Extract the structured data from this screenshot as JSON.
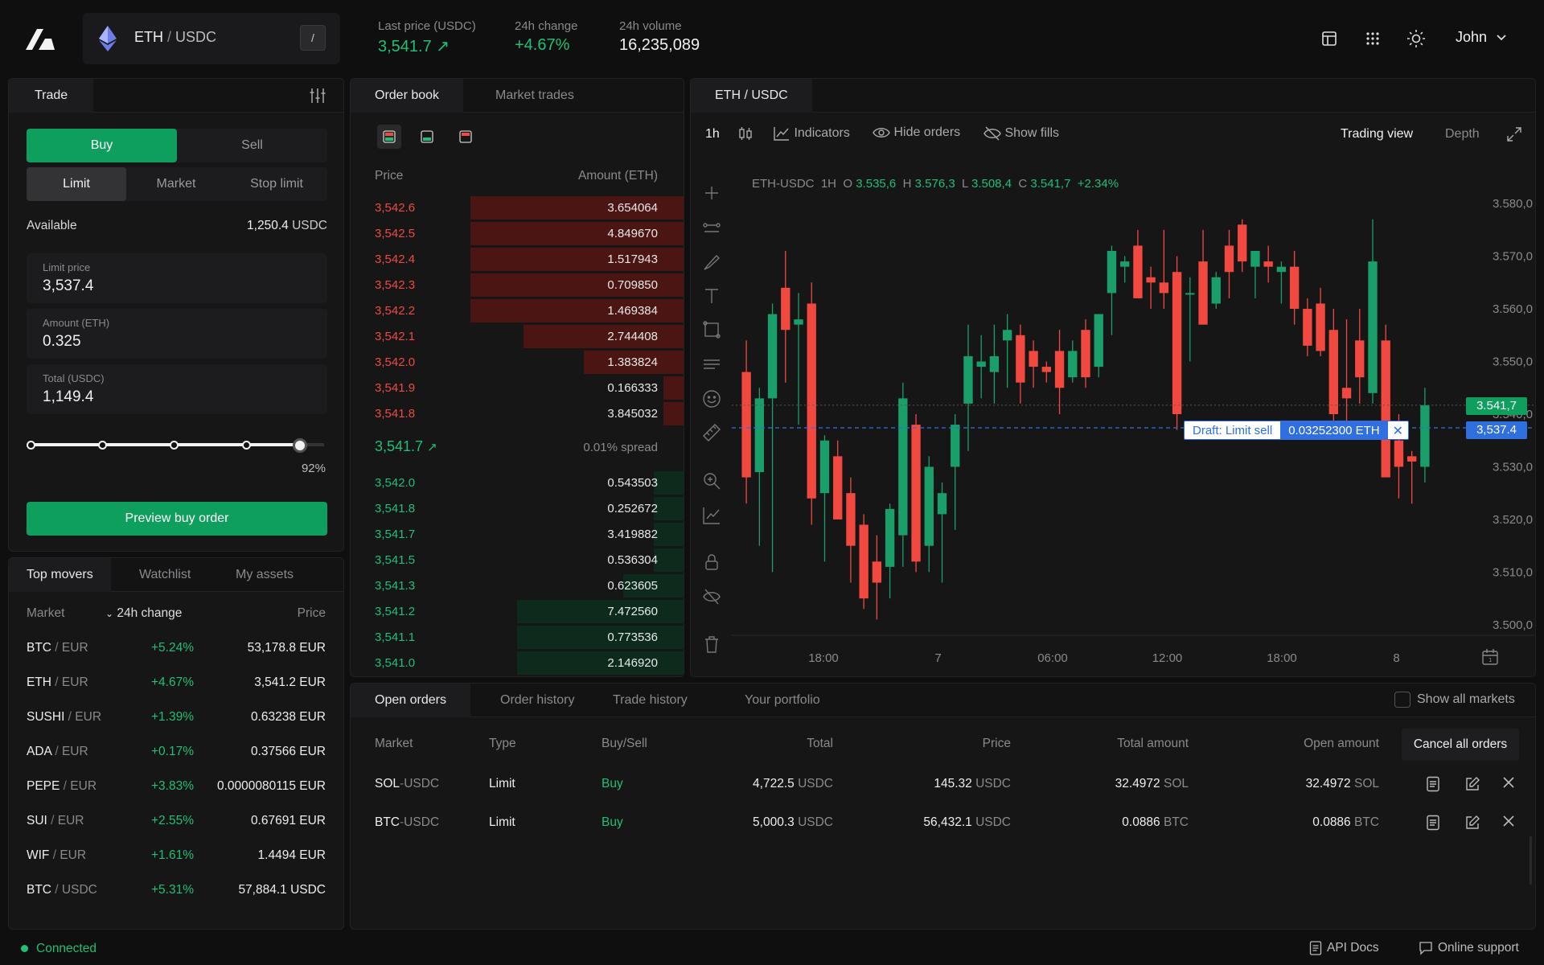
{
  "header": {
    "pair_base": "ETH",
    "pair_sep": "/",
    "pair_quote": "USDC",
    "shortcut": "/",
    "last_price_label": "Last price (USDC)",
    "last_price": "3,541.7",
    "change_label": "24h change",
    "change": "+4.67%",
    "volume_label": "24h volume",
    "volume": "16,235,089",
    "user": "John"
  },
  "trade": {
    "tab": "Trade",
    "buy": "Buy",
    "sell": "Sell",
    "order_types": [
      "Limit",
      "Market",
      "Stop limit"
    ],
    "available_label": "Available",
    "available_value": "1,250.4",
    "available_unit": "USDC",
    "limit_label": "Limit price",
    "limit_value": "3,537.4",
    "amount_label": "Amount (ETH)",
    "amount_value": "0.325",
    "total_label": "Total (USDC)",
    "total_value": "1,149.4",
    "slider_percent": 92,
    "slider_label": "92%",
    "preview_button": "Preview buy order"
  },
  "movers": {
    "tabs": [
      "Top movers",
      "Watchlist",
      "My assets"
    ],
    "col_market": "Market",
    "col_change": "24h change",
    "col_price": "Price",
    "rows": [
      {
        "base": "BTC",
        "quote": "EUR",
        "change": "+5.24%",
        "price": "53,178.8 EUR"
      },
      {
        "base": "ETH",
        "quote": "EUR",
        "change": "+4.67%",
        "price": "3,541.2 EUR"
      },
      {
        "base": "SUSHI",
        "quote": "EUR",
        "change": "+1.39%",
        "price": "0.63238 EUR"
      },
      {
        "base": "ADA",
        "quote": "EUR",
        "change": "+0.17%",
        "price": "0.37566 EUR"
      },
      {
        "base": "PEPE",
        "quote": "EUR",
        "change": "+3.83%",
        "price": "0.0000080115 EUR"
      },
      {
        "base": "SUI",
        "quote": "EUR",
        "change": "+2.55%",
        "price": "0.67691 EUR"
      },
      {
        "base": "WIF",
        "quote": "EUR",
        "change": "+1.61%",
        "price": "1.4494 EUR"
      },
      {
        "base": "BTC",
        "quote": "USDC",
        "change": "+5.31%",
        "price": "57,884.1 USDC"
      }
    ]
  },
  "orderbook": {
    "tabs": [
      "Order book",
      "Market trades"
    ],
    "col_price": "Price",
    "col_amount": "Amount (ETH)",
    "asks": [
      {
        "price": "3,542.6",
        "amount": "3.654064",
        "depth": 0.64
      },
      {
        "price": "3,542.5",
        "amount": "4.849670",
        "depth": 0.64
      },
      {
        "price": "3,542.4",
        "amount": "1.517943",
        "depth": 0.64
      },
      {
        "price": "3,542.3",
        "amount": "0.709850",
        "depth": 0.64
      },
      {
        "price": "3,542.2",
        "amount": "1.469384",
        "depth": 0.64
      },
      {
        "price": "3,542.1",
        "amount": "2.744408",
        "depth": 0.48
      },
      {
        "price": "3,542.0",
        "amount": "1.383824",
        "depth": 0.3
      },
      {
        "price": "3,541.9",
        "amount": "0.166333",
        "depth": 0.06
      },
      {
        "price": "3,541.8",
        "amount": "3.845032",
        "depth": 0.06
      }
    ],
    "mid_price": "3,541.7",
    "spread": "0.01% spread",
    "bids": [
      {
        "price": "3,542.0",
        "amount": "0.543503",
        "depth": 0.09
      },
      {
        "price": "3,541.8",
        "amount": "0.252672",
        "depth": 0.09
      },
      {
        "price": "3,541.7",
        "amount": "3.419882",
        "depth": 0.09
      },
      {
        "price": "3,541.5",
        "amount": "0.536304",
        "depth": 0.09
      },
      {
        "price": "3,541.3",
        "amount": "0.623605",
        "depth": 0.18
      },
      {
        "price": "3,541.2",
        "amount": "7.472560",
        "depth": 0.5
      },
      {
        "price": "3,541.1",
        "amount": "0.773536",
        "depth": 0.5
      },
      {
        "price": "3,541.0",
        "amount": "2.146920",
        "depth": 0.5
      }
    ]
  },
  "chart": {
    "tab": "ETH / USDC",
    "interval": "1h",
    "indicators": "Indicators",
    "hide_orders": "Hide orders",
    "show_fills": "Show fills",
    "trading_view": "Trading view",
    "depth": "Depth",
    "legend_symbol": "ETH-USDC",
    "legend_tf": "1H",
    "legend_o_label": "O",
    "legend_o": "3.535,6",
    "legend_h_label": "H",
    "legend_h": "3.576,3",
    "legend_l_label": "L",
    "legend_l": "3.508,4",
    "legend_c_label": "C",
    "legend_c": "3.541,7",
    "legend_change": "+2.34%",
    "draft_label": "Draft: Limit sell",
    "draft_amount": "0.03252300 ETH",
    "last_tag": "3.541,7",
    "limit_tag": "3,537.4",
    "colors": {
      "up": "#1a9e6a",
      "down": "#f1493f",
      "draft": "#2f6fe0"
    }
  },
  "chart_data": {
    "type": "candlestick",
    "y_ticks": [
      "3.580,0",
      "3.570,0",
      "3.560,0",
      "3.550,0",
      "3.540,0",
      "3.530,0",
      "3.520,0",
      "3.510,0",
      "3.500,0"
    ],
    "ylim": [
      3498,
      3582
    ],
    "x_ticks": [
      "18:00",
      "7",
      "06:00",
      "12:00",
      "18:00",
      "8"
    ],
    "last_price": 3541.7,
    "limit_price": 3537.4,
    "candles": [
      {
        "o": 3548,
        "h": 3554,
        "l": 3523,
        "c": 3528
      },
      {
        "o": 3529,
        "h": 3545,
        "l": 3515,
        "c": 3543
      },
      {
        "o": 3543,
        "h": 3561,
        "l": 3510,
        "c": 3559
      },
      {
        "o": 3564,
        "h": 3571,
        "l": 3546,
        "c": 3556
      },
      {
        "o": 3557,
        "h": 3563,
        "l": 3538,
        "c": 3558
      },
      {
        "o": 3561,
        "h": 3565,
        "l": 3519,
        "c": 3524
      },
      {
        "o": 3525,
        "h": 3536,
        "l": 3512,
        "c": 3535
      },
      {
        "o": 3532,
        "h": 3535,
        "l": 3521,
        "c": 3520
      },
      {
        "o": 3525,
        "h": 3528,
        "l": 3508,
        "c": 3515
      },
      {
        "o": 3519,
        "h": 3521,
        "l": 3503,
        "c": 3505
      },
      {
        "o": 3512,
        "h": 3517,
        "l": 3501,
        "c": 3508
      },
      {
        "o": 3511,
        "h": 3523,
        "l": 3505,
        "c": 3522
      },
      {
        "o": 3517,
        "h": 3546,
        "l": 3511,
        "c": 3543
      },
      {
        "o": 3538,
        "h": 3540,
        "l": 3510,
        "c": 3512
      },
      {
        "o": 3515,
        "h": 3532,
        "l": 3510,
        "c": 3530
      },
      {
        "o": 3521,
        "h": 3527,
        "l": 3508,
        "c": 3525
      },
      {
        "o": 3530,
        "h": 3540,
        "l": 3518,
        "c": 3538
      },
      {
        "o": 3542,
        "h": 3557,
        "l": 3533,
        "c": 3551
      },
      {
        "o": 3549,
        "h": 3555,
        "l": 3543,
        "c": 3550
      },
      {
        "o": 3548,
        "h": 3557,
        "l": 3542,
        "c": 3551
      },
      {
        "o": 3554,
        "h": 3559,
        "l": 3545,
        "c": 3556
      },
      {
        "o": 3555,
        "h": 3557,
        "l": 3542,
        "c": 3546
      },
      {
        "o": 3552,
        "h": 3554,
        "l": 3545,
        "c": 3549
      },
      {
        "o": 3549,
        "h": 3550,
        "l": 3546,
        "c": 3548
      },
      {
        "o": 3552,
        "h": 3556,
        "l": 3540,
        "c": 3545
      },
      {
        "o": 3547,
        "h": 3554,
        "l": 3546,
        "c": 3552
      },
      {
        "o": 3556,
        "h": 3558,
        "l": 3545,
        "c": 3547
      },
      {
        "o": 3549,
        "h": 3559,
        "l": 3547,
        "c": 3559
      },
      {
        "o": 3563,
        "h": 3572,
        "l": 3555,
        "c": 3571
      },
      {
        "o": 3568,
        "h": 3570,
        "l": 3565,
        "c": 3569
      },
      {
        "o": 3572,
        "h": 3575,
        "l": 3562,
        "c": 3562
      },
      {
        "o": 3566,
        "h": 3568,
        "l": 3560,
        "c": 3565
      },
      {
        "o": 3565,
        "h": 3575,
        "l": 3560,
        "c": 3563
      },
      {
        "o": 3567,
        "h": 3570,
        "l": 3537,
        "c": 3540
      },
      {
        "o": 3563,
        "h": 3566,
        "l": 3550,
        "c": 3563
      },
      {
        "o": 3569,
        "h": 3575,
        "l": 3557,
        "c": 3557
      },
      {
        "o": 3561,
        "h": 3567,
        "l": 3560,
        "c": 3566
      },
      {
        "o": 3572,
        "h": 3575,
        "l": 3562,
        "c": 3567
      },
      {
        "o": 3576,
        "h": 3577,
        "l": 3567,
        "c": 3569
      },
      {
        "o": 3568,
        "h": 3571,
        "l": 3562,
        "c": 3571
      },
      {
        "o": 3569,
        "h": 3572,
        "l": 3565,
        "c": 3568
      },
      {
        "o": 3567,
        "h": 3569,
        "l": 3561,
        "c": 3568
      },
      {
        "o": 3568,
        "h": 3571,
        "l": 3557,
        "c": 3560
      },
      {
        "o": 3560,
        "h": 3562,
        "l": 3551,
        "c": 3553
      },
      {
        "o": 3561,
        "h": 3564,
        "l": 3551,
        "c": 3552
      },
      {
        "o": 3556,
        "h": 3560,
        "l": 3538,
        "c": 3540
      },
      {
        "o": 3545,
        "h": 3558,
        "l": 3538,
        "c": 3543
      },
      {
        "o": 3554,
        "h": 3560,
        "l": 3542,
        "c": 3547
      },
      {
        "o": 3544,
        "h": 3577,
        "l": 3542,
        "c": 3569
      },
      {
        "o": 3554,
        "h": 3557,
        "l": 3528,
        "c": 3528
      },
      {
        "o": 3535,
        "h": 3540,
        "l": 3524,
        "c": 3530
      },
      {
        "o": 3532,
        "h": 3533,
        "l": 3523,
        "c": 3531
      },
      {
        "o": 3530,
        "h": 3545,
        "l": 3527,
        "c": 3541.7
      }
    ]
  },
  "orders": {
    "tabs": [
      "Open orders",
      "Order history",
      "Trade history",
      "Your portfolio"
    ],
    "show_all": "Show all markets",
    "cols": [
      "Market",
      "Type",
      "Buy/Sell",
      "Total",
      "Price",
      "Total amount",
      "Open amount"
    ],
    "cancel_all": "Cancel all orders",
    "rows": [
      {
        "base": "SOL",
        "quote": "USDC",
        "type": "Limit",
        "side": "Buy",
        "total": "4,722.5",
        "total_unit": "USDC",
        "price": "145.32",
        "price_unit": "USDC",
        "amount": "32.4972",
        "amount_unit": "SOL",
        "open": "32.4972",
        "open_unit": "SOL"
      },
      {
        "base": "BTC",
        "quote": "USDC",
        "type": "Limit",
        "side": "Buy",
        "total": "5,000.3",
        "total_unit": "USDC",
        "price": "56,432.1",
        "price_unit": "USDC",
        "amount": "0.0886",
        "amount_unit": "BTC",
        "open": "0.0886",
        "open_unit": "BTC"
      }
    ]
  },
  "footer": {
    "status": "Connected",
    "api": "API Docs",
    "support": "Online support"
  }
}
